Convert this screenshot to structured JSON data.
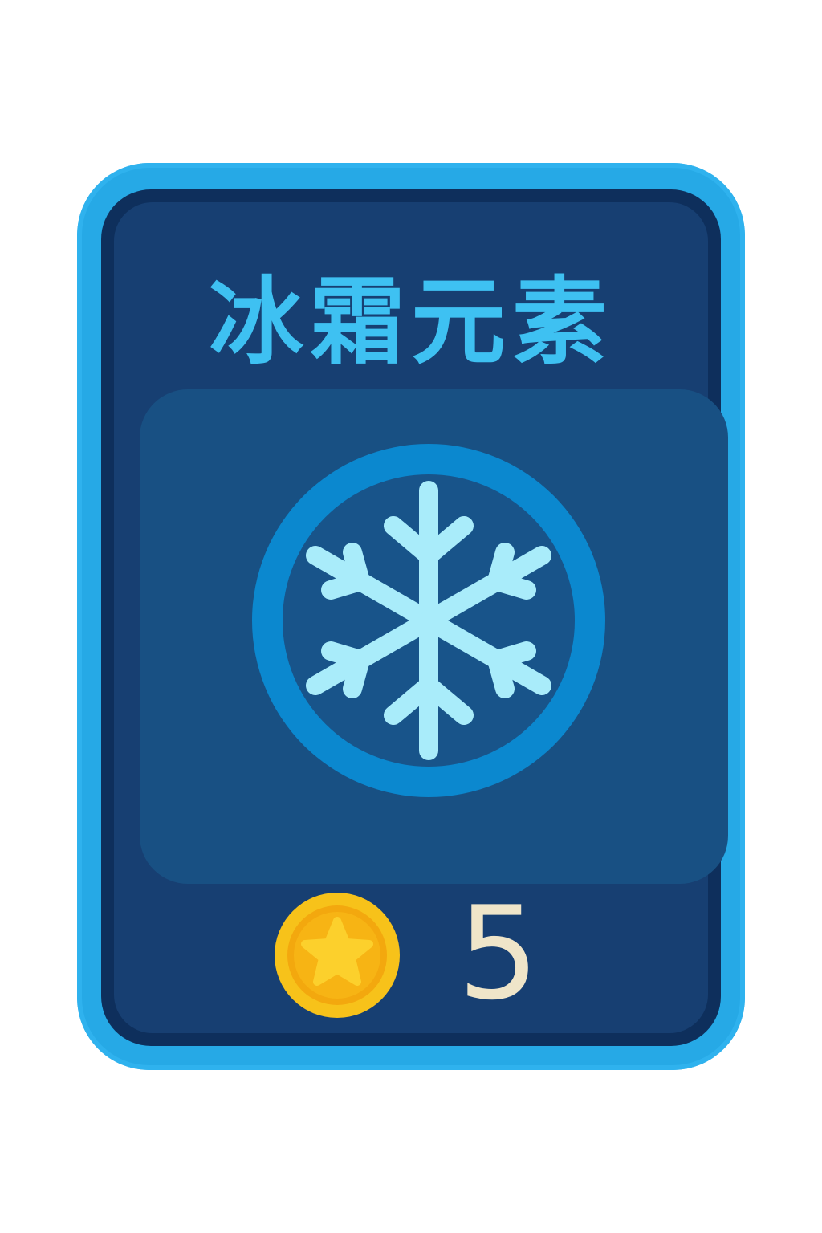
{
  "card": {
    "title": "冰霜元素",
    "element_icon": "snowflake-icon",
    "cost_icon": "coin-star-icon",
    "cost": "5"
  },
  "colors": {
    "frame": "#26a9e6",
    "rim": "#0e2f5c",
    "face": "#173f72",
    "panel": "#185083",
    "title": "#3ec1f2",
    "emblem_ring": "#0b88cf",
    "snowflake": "#a9ecfa",
    "coin": "#f7b414",
    "cost_text": "#efe5c9"
  }
}
